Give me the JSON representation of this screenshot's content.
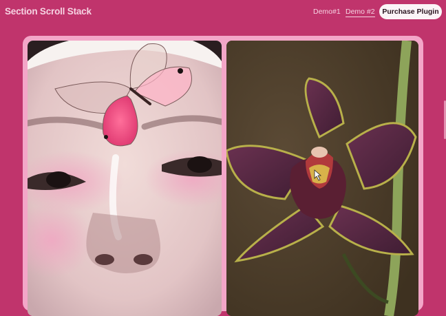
{
  "header": {
    "title": "Section Scroll Stack",
    "nav": [
      {
        "label": "Demo#1"
      },
      {
        "label": "Demo #2",
        "active": true
      }
    ],
    "cta_label": "Purchase Plugin"
  },
  "cards": [
    {
      "subject": "face-with-butterfly-photo"
    },
    {
      "subject": "orchid-flower-photo"
    }
  ],
  "colors": {
    "background": "#c0346c",
    "card_frame": "#f3a6c8",
    "header_text": "#f6d3e2",
    "button_bg": "#fbf4f7"
  }
}
